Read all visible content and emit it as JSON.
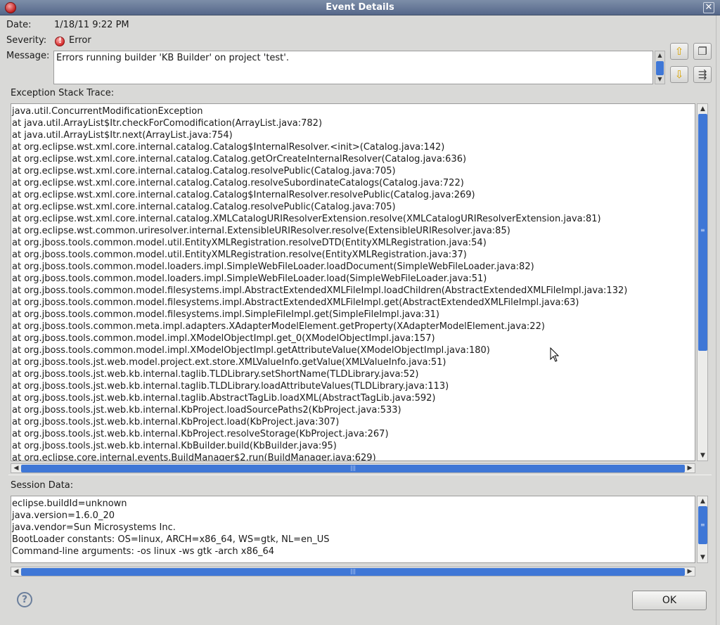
{
  "window": {
    "title": "Event Details"
  },
  "fields": {
    "date_label": "Date:",
    "date_value": "1/18/11 9:22 PM",
    "severity_label": "Severity:",
    "severity_value": "Error",
    "message_label": "Message:",
    "message_value": "Errors running builder 'KB Builder' on project 'test'."
  },
  "trace": {
    "label": "Exception Stack Trace:",
    "lines": [
      "java.util.ConcurrentModificationException",
      "at java.util.ArrayList$Itr.checkForComodification(ArrayList.java:782)",
      "at java.util.ArrayList$Itr.next(ArrayList.java:754)",
      "at org.eclipse.wst.xml.core.internal.catalog.Catalog$InternalResolver.<init>(Catalog.java:142)",
      "at org.eclipse.wst.xml.core.internal.catalog.Catalog.getOrCreateInternalResolver(Catalog.java:636)",
      "at org.eclipse.wst.xml.core.internal.catalog.Catalog.resolvePublic(Catalog.java:705)",
      "at org.eclipse.wst.xml.core.internal.catalog.Catalog.resolveSubordinateCatalogs(Catalog.java:722)",
      "at org.eclipse.wst.xml.core.internal.catalog.Catalog$InternalResolver.resolvePublic(Catalog.java:269)",
      "at org.eclipse.wst.xml.core.internal.catalog.Catalog.resolvePublic(Catalog.java:705)",
      "at org.eclipse.wst.xml.core.internal.catalog.XMLCatalogURIResolverExtension.resolve(XMLCatalogURIResolverExtension.java:81)",
      "at org.eclipse.wst.common.uriresolver.internal.ExtensibleURIResolver.resolve(ExtensibleURIResolver.java:85)",
      "at org.jboss.tools.common.model.util.EntityXMLRegistration.resolveDTD(EntityXMLRegistration.java:54)",
      "at org.jboss.tools.common.model.util.EntityXMLRegistration.resolve(EntityXMLRegistration.java:37)",
      "at org.jboss.tools.common.model.loaders.impl.SimpleWebFileLoader.loadDocument(SimpleWebFileLoader.java:82)",
      "at org.jboss.tools.common.model.loaders.impl.SimpleWebFileLoader.load(SimpleWebFileLoader.java:51)",
      "at org.jboss.tools.common.model.filesystems.impl.AbstractExtendedXMLFileImpl.loadChildren(AbstractExtendedXMLFileImpl.java:132)",
      "at org.jboss.tools.common.model.filesystems.impl.AbstractExtendedXMLFileImpl.get(AbstractExtendedXMLFileImpl.java:63)",
      "at org.jboss.tools.common.model.filesystems.impl.SimpleFileImpl.get(SimpleFileImpl.java:31)",
      "at org.jboss.tools.common.meta.impl.adapters.XAdapterModelElement.getProperty(XAdapterModelElement.java:22)",
      "at org.jboss.tools.common.model.impl.XModelObjectImpl.get_0(XModelObjectImpl.java:157)",
      "at org.jboss.tools.common.model.impl.XModelObjectImpl.getAttributeValue(XModelObjectImpl.java:180)",
      "at org.jboss.tools.jst.web.model.project.ext.store.XMLValueInfo.getValue(XMLValueInfo.java:51)",
      "at org.jboss.tools.jst.web.kb.internal.taglib.TLDLibrary.setShortName(TLDLibrary.java:52)",
      "at org.jboss.tools.jst.web.kb.internal.taglib.TLDLibrary.loadAttributeValues(TLDLibrary.java:113)",
      "at org.jboss.tools.jst.web.kb.internal.taglib.AbstractTagLib.loadXML(AbstractTagLib.java:592)",
      "at org.jboss.tools.jst.web.kb.internal.KbProject.loadSourcePaths2(KbProject.java:533)",
      "at org.jboss.tools.jst.web.kb.internal.KbProject.load(KbProject.java:307)",
      "at org.jboss.tools.jst.web.kb.internal.KbProject.resolveStorage(KbProject.java:267)",
      "at org.jboss.tools.jst.web.kb.internal.KbBuilder.build(KbBuilder.java:95)",
      "at org.eclipse.core.internal.events.BuildManager$2.run(BuildManager.java:629)"
    ]
  },
  "session": {
    "label": "Session Data:",
    "lines": [
      "eclipse.buildId=unknown",
      "java.version=1.6.0_20",
      "java.vendor=Sun Microsystems Inc.",
      "BootLoader constants: OS=linux, ARCH=x86_64, WS=gtk, NL=en_US",
      "Command-line arguments:  -os linux -ws gtk -arch x86_64"
    ]
  },
  "buttons": {
    "ok": "OK"
  },
  "colors": {
    "titlebar": "#55678a",
    "scroll_thumb": "#3f77d6"
  }
}
